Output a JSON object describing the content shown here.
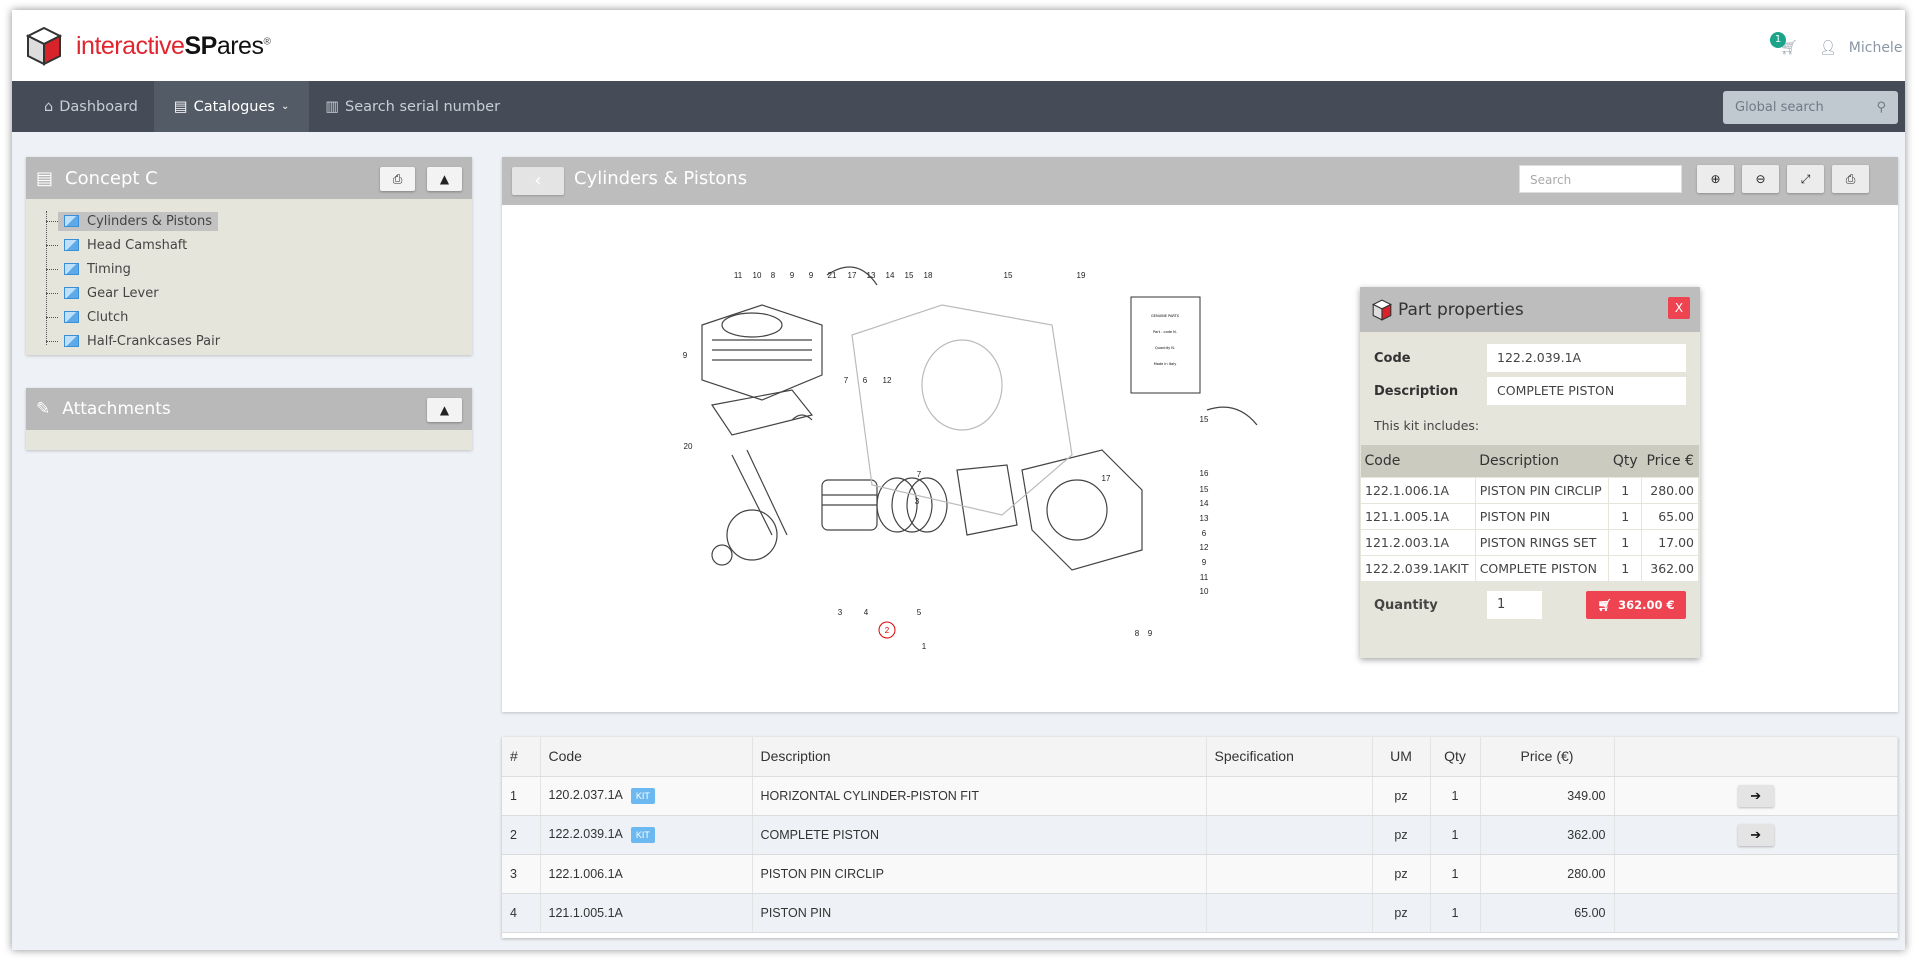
{
  "app": {
    "brand_a": "interactive",
    "brand_b": "SP",
    "brand_c": "ares",
    "brand_reg": "®"
  },
  "header": {
    "cart_count": "1",
    "user": "Michele"
  },
  "nav": {
    "items": [
      {
        "label": "Dashboard",
        "icon": "home-icon"
      },
      {
        "label": "Catalogues",
        "icon": "book-icon",
        "active": true
      },
      {
        "label": "Search serial number",
        "icon": "barcode-icon"
      }
    ],
    "global_search_placeholder": "Global search"
  },
  "catalogue": {
    "title": "Concept C",
    "items": [
      "Cylinders & Pistons",
      "Head Camshaft",
      "Timing",
      "Gear Lever",
      "Clutch",
      "Half-Crankcases Pair"
    ],
    "selected": "Cylinders & Pistons"
  },
  "attachments": {
    "title": "Attachments"
  },
  "viewer": {
    "title": "Cylinders & Pistons",
    "search_placeholder": "Search",
    "highlighted_callout": "2",
    "callouts": [
      "11",
      "10",
      "8",
      "9",
      "9",
      "21",
      "17",
      "13",
      "14",
      "15",
      "18",
      "15",
      "19",
      "9",
      "20",
      "7",
      "6",
      "12",
      "15",
      "16",
      "15",
      "14",
      "13",
      "6",
      "12",
      "9",
      "11",
      "10",
      "17",
      "7",
      "3",
      "3",
      "4",
      "5",
      "2",
      "1",
      "8",
      "9"
    ],
    "booklet": [
      "GENUINE PARTS",
      "Part - code N.",
      "Quantity N.",
      "Made in Italy"
    ]
  },
  "part_properties": {
    "title": "Part properties",
    "close": "X",
    "code_label": "Code",
    "code": "122.2.039.1A",
    "desc_label": "Description",
    "description": "COMPLETE PISTON",
    "kit_label": "This kit includes:",
    "columns": [
      "Code",
      "Description",
      "Qty",
      "Price €"
    ],
    "rows": [
      [
        "122.1.006.1A",
        "PISTON PIN CIRCLIP",
        "1",
        "280.00"
      ],
      [
        "121.1.005.1A",
        "PISTON PIN",
        "1",
        "65.00"
      ],
      [
        "121.2.003.1A",
        "PISTON RINGS SET",
        "1",
        "17.00"
      ],
      [
        "122.2.039.1AKIT",
        "COMPLETE PISTON",
        "1",
        "362.00"
      ]
    ],
    "qty_label": "Quantity",
    "qty": "1",
    "buy_label": "362.00 €"
  },
  "parts": {
    "columns": [
      "#",
      "Code",
      "Description",
      "Specification",
      "UM",
      "Qty",
      "Price (€)",
      ""
    ],
    "rows": [
      {
        "n": "1",
        "code": "120.2.037.1A",
        "kit": "KIT",
        "desc": "HORIZONTAL CYLINDER-PISTON FIT",
        "spec": "",
        "um": "pz",
        "qty": "1",
        "price": "349.00",
        "action": "arrow"
      },
      {
        "n": "2",
        "code": "122.2.039.1A",
        "kit": "KIT",
        "desc": "COMPLETE PISTON",
        "spec": "",
        "um": "pz",
        "qty": "1",
        "price": "362.00",
        "action": "arrow"
      },
      {
        "n": "3",
        "code": "122.1.006.1A",
        "kit": "",
        "desc": "PISTON PIN CIRCLIP",
        "spec": "",
        "um": "pz",
        "qty": "1",
        "price": "280.00",
        "action": "cart-disabled"
      },
      {
        "n": "4",
        "code": "121.1.005.1A",
        "kit": "",
        "desc": "PISTON PIN",
        "spec": "",
        "um": "pz",
        "qty": "1",
        "price": "65.00",
        "action": "cart"
      }
    ]
  },
  "colors": {
    "nav": "#454c57",
    "accent_red": "#ee4452",
    "kit_badge": "#6cb8f0",
    "cart_badge": "#1aa58a"
  }
}
